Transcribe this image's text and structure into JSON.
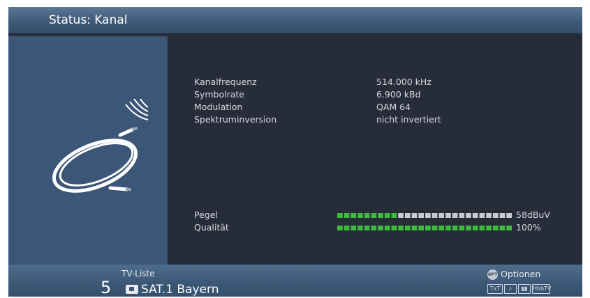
{
  "header": {
    "title": "Status: Kanal"
  },
  "channel_info": [
    {
      "label": "Kanalfrequenz",
      "value": "514.000 kHz"
    },
    {
      "label": "Symbolrate",
      "value": "6.900 kBd"
    },
    {
      "label": "Modulation",
      "value": "QAM 64"
    },
    {
      "label": "Spektruminversion",
      "value": "nicht invertiert"
    }
  ],
  "signal": {
    "pegel": {
      "label": "Pegel",
      "value": "58dBuV",
      "segments_total": 26,
      "segments_active": 9
    },
    "qualitaet": {
      "label": "Qualität",
      "value": "100%",
      "segments_total": 26,
      "segments_active": 26
    }
  },
  "footer": {
    "list_label": "TV-Liste",
    "channel_number": "5",
    "channel_name": "SAT.1 Bayern",
    "opt_button_label": "OPT",
    "options_label": "Optionen",
    "badges": [
      "TxT",
      "⌕",
      "▮▮",
      "HbbTV"
    ]
  },
  "colors": {
    "accent_active": "#3dbb3d",
    "segment_inactive": "#c8ccd2",
    "background": "#262c38",
    "header": "#3f5a78"
  },
  "icons": {
    "left_panel": "coax-cable-icon",
    "signal": "signal-waves-icon"
  }
}
